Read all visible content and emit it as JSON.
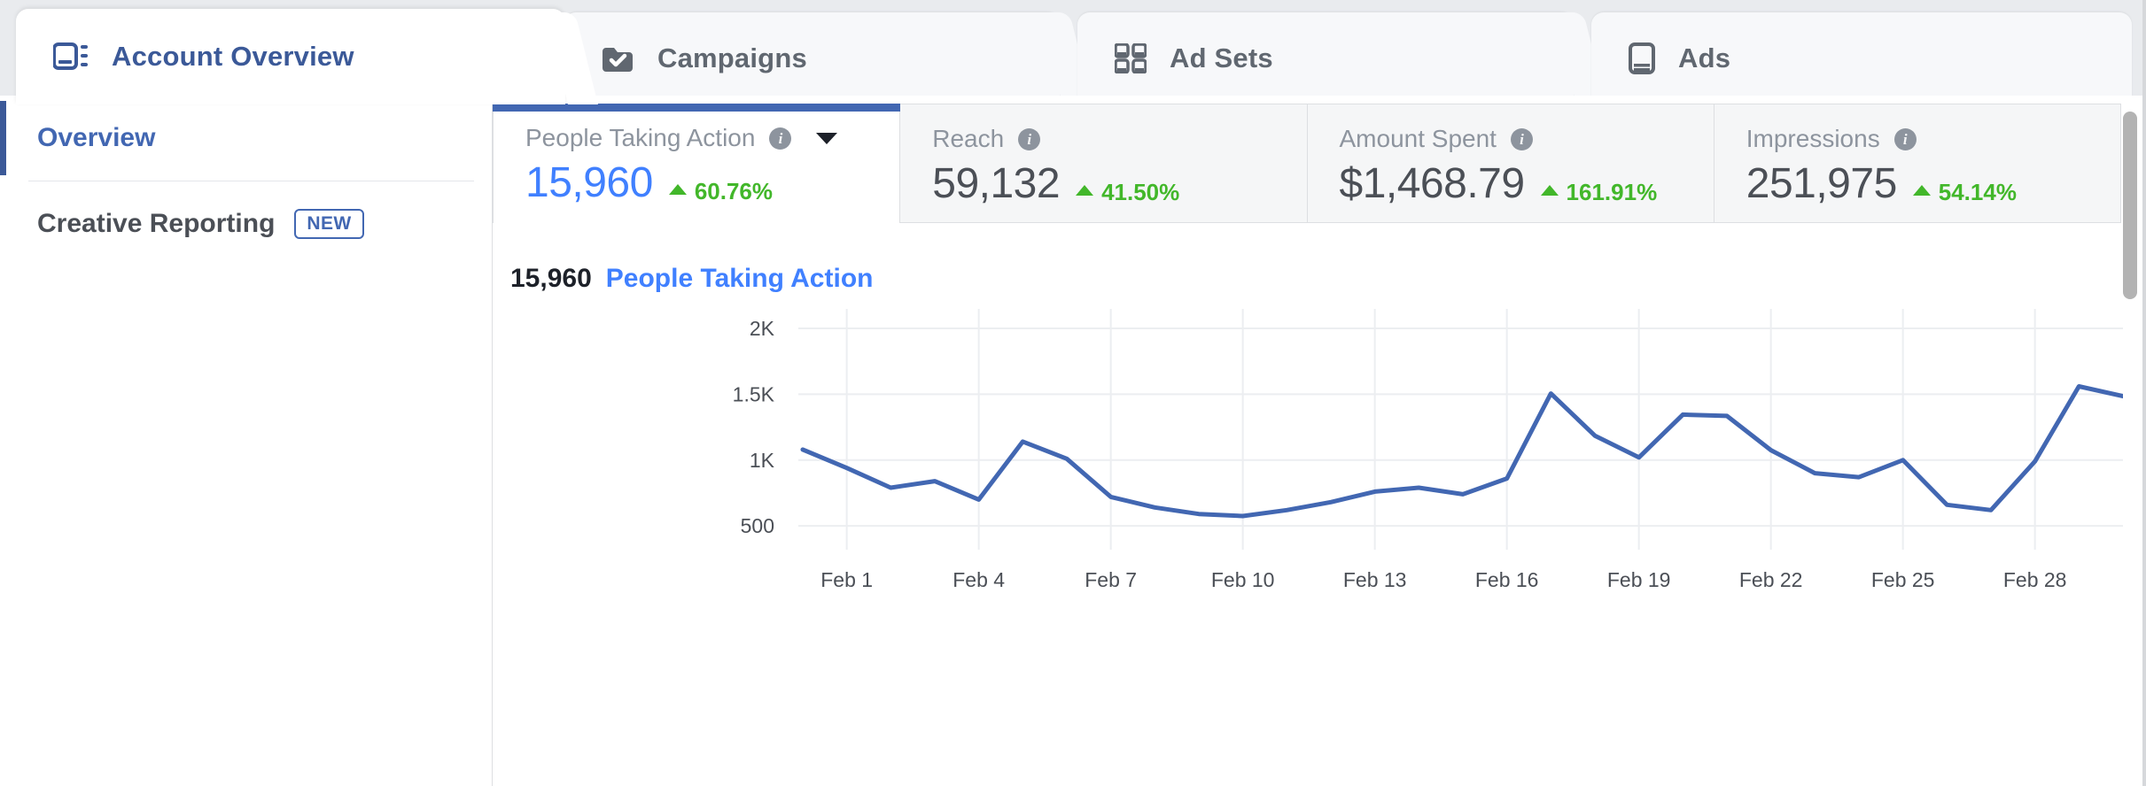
{
  "tabs": [
    {
      "label": "Account Overview",
      "icon": "account-overview-icon",
      "active": true
    },
    {
      "label": "Campaigns",
      "icon": "campaigns-icon",
      "active": false
    },
    {
      "label": "Ad Sets",
      "icon": "ad-sets-icon",
      "active": false
    },
    {
      "label": "Ads",
      "icon": "ads-icon",
      "active": false
    }
  ],
  "sidebar": {
    "items": [
      {
        "label": "Overview",
        "selected": true
      },
      {
        "label": "Creative Reporting",
        "badge": "NEW",
        "selected": false
      }
    ]
  },
  "kpis": [
    {
      "title": "People Taking Action",
      "value": "15,960",
      "delta": "60.76%",
      "direction": "up",
      "active": true,
      "has_dropdown": true
    },
    {
      "title": "Reach",
      "value": "59,132",
      "delta": "41.50%",
      "direction": "up",
      "active": false,
      "has_dropdown": false
    },
    {
      "title": "Amount Spent",
      "value": "$1,468.79",
      "delta": "161.91%",
      "direction": "up",
      "active": false,
      "has_dropdown": false
    },
    {
      "title": "Impressions",
      "value": "251,975",
      "delta": "54.14%",
      "direction": "up",
      "active": false,
      "has_dropdown": false
    }
  ],
  "chart_caption": {
    "number": "15,960",
    "label": "People Taking Action"
  },
  "colors": {
    "accent_blue": "#4267b2",
    "line_blue": "#4267b2",
    "value_blue": "#4080ff",
    "green": "#42b72a",
    "text_dark": "#1d2129",
    "text_muted": "#8d949e"
  },
  "chart_data": {
    "type": "line",
    "title": "15,960 People Taking Action",
    "xlabel": "",
    "ylabel": "",
    "grid": true,
    "legend": false,
    "ylim": [
      400,
      2000
    ],
    "yticks": [
      500,
      1000,
      1500,
      2000
    ],
    "ytick_labels": [
      "500",
      "1K",
      "1.5K",
      "2K"
    ],
    "xtick_labels": [
      "Feb 1",
      "Feb 4",
      "Feb 7",
      "Feb 10",
      "Feb 13",
      "Feb 16",
      "Feb 19",
      "Feb 22",
      "Feb 25",
      "Feb 28"
    ],
    "x": [
      "Feb 1",
      "Feb 2",
      "Feb 3",
      "Feb 4",
      "Feb 5",
      "Feb 6",
      "Feb 7",
      "Feb 8",
      "Feb 9",
      "Feb 10",
      "Feb 11",
      "Feb 12",
      "Feb 13",
      "Feb 14",
      "Feb 15",
      "Feb 16",
      "Feb 17",
      "Feb 18",
      "Feb 19",
      "Feb 20",
      "Feb 21",
      "Feb 22",
      "Feb 23",
      "Feb 24",
      "Feb 25",
      "Feb 26",
      "Feb 27",
      "Feb 28",
      "Feb 29"
    ],
    "series": [
      {
        "name": "People Taking Action",
        "color": "#4267b2",
        "values": [
          1080,
          940,
          790,
          840,
          700,
          1140,
          1010,
          720,
          640,
          590,
          575,
          620,
          680,
          760,
          790,
          740,
          860,
          1505,
          1185,
          1020,
          1345,
          1335,
          1075,
          900,
          870,
          1000,
          660,
          620,
          990,
          1560,
          1485
        ]
      }
    ]
  }
}
